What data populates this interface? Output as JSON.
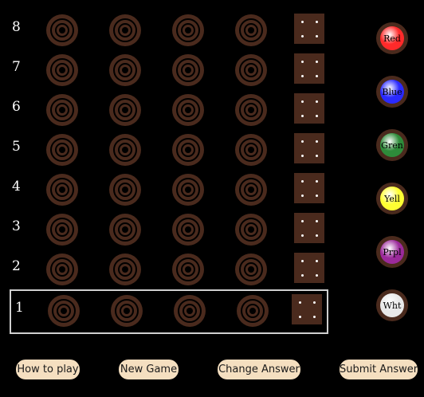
{
  "rows": [
    {
      "label": "8"
    },
    {
      "label": "7"
    },
    {
      "label": "6"
    },
    {
      "label": "5"
    },
    {
      "label": "4"
    },
    {
      "label": "3"
    },
    {
      "label": "2"
    },
    {
      "label": "1"
    }
  ],
  "active_row": "1",
  "holes_per_row": 4,
  "palette": [
    {
      "label": "Red",
      "color": "#ff2a2a",
      "text_color": "#000000",
      "icon": "red-peg-icon"
    },
    {
      "label": "Blue",
      "color": "#2a2aff",
      "text_color": "#000000",
      "icon": "blue-peg-icon"
    },
    {
      "label": "Gren",
      "color": "#2e8b3a",
      "text_color": "#000000",
      "icon": "green-peg-icon"
    },
    {
      "label": "Yell",
      "color": "#ffff33",
      "text_color": "#000000",
      "icon": "yellow-peg-icon"
    },
    {
      "label": "Prpl",
      "color": "#9b2a9b",
      "text_color": "#000000",
      "icon": "purple-peg-icon"
    },
    {
      "label": "Wht",
      "color": "#e8e8e8",
      "text_color": "#000000",
      "icon": "white-peg-icon"
    }
  ],
  "buttons": {
    "how_to_play": "How to play",
    "new_game": "New Game",
    "change_answer": "Change Answer",
    "submit_answer": "Submit Answer"
  },
  "colors": {
    "background": "#000000",
    "wood": "#4a2a1d",
    "button_bg": "#f5dfc0",
    "active_frame": "#cfcfcf"
  }
}
